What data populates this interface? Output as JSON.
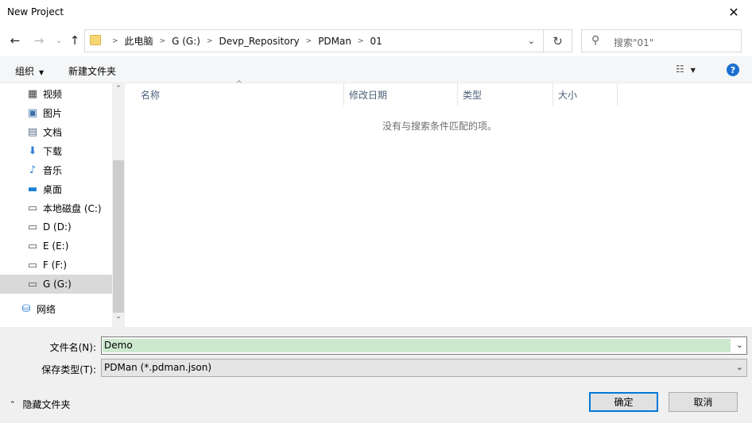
{
  "window": {
    "title": "New Project",
    "close_glyph": "✕"
  },
  "nav": {
    "back_glyph": "←",
    "forward_glyph": "→",
    "recent_glyph": "⌄",
    "up_glyph": "↑",
    "breadcrumbs": [
      "此电脑",
      "G (G:)",
      "Devp_Repository",
      "PDMan",
      "01"
    ],
    "crumb_separator": ">",
    "dropdown_glyph": "⌄",
    "refresh_glyph": "↻"
  },
  "search": {
    "placeholder": "搜索\"01\"",
    "icon": "search-icon"
  },
  "toolbar": {
    "organize_label": "组织",
    "new_folder_label": "新建文件夹",
    "view_glyph": "☷",
    "help_glyph": "?"
  },
  "sidebar": {
    "items": [
      {
        "label": "视频",
        "icon": "video-icon",
        "glyph": "▦",
        "color": "#444444"
      },
      {
        "label": "图片",
        "icon": "pictures-icon",
        "glyph": "▣",
        "color": "#3c6fa8"
      },
      {
        "label": "文档",
        "icon": "documents-icon",
        "glyph": "▤",
        "color": "#5a6f88"
      },
      {
        "label": "下载",
        "icon": "download-icon",
        "glyph": "⬇",
        "color": "#2f7fd6"
      },
      {
        "label": "音乐",
        "icon": "music-icon",
        "glyph": "♪",
        "color": "#2f7fd6"
      },
      {
        "label": "桌面",
        "icon": "desktop-icon",
        "glyph": "▬",
        "color": "#1f7fd3"
      },
      {
        "label": "本地磁盘 (C:)",
        "icon": "system-drive-icon",
        "glyph": "▭",
        "color": "#555555"
      },
      {
        "label": "D (D:)",
        "icon": "drive-icon",
        "glyph": "▭",
        "color": "#555555"
      },
      {
        "label": "E (E:)",
        "icon": "drive-icon",
        "glyph": "▭",
        "color": "#555555"
      },
      {
        "label": "F (F:)",
        "icon": "drive-icon",
        "glyph": "▭",
        "color": "#555555"
      },
      {
        "label": "G (G:)",
        "icon": "drive-icon",
        "glyph": "▭",
        "color": "#555555",
        "selected": true
      },
      {
        "label": "网络",
        "icon": "network-icon",
        "glyph": "⛁",
        "color": "#2f7fd6"
      }
    ],
    "scroll_up_glyph": "⌃",
    "scroll_down_glyph": "⌄"
  },
  "filelist": {
    "columns": [
      "名称",
      "修改日期",
      "类型",
      "大小"
    ],
    "sort_glyph": "^",
    "empty_message": "没有与搜索条件匹配的项。"
  },
  "form": {
    "filename_label": "文件名(N):",
    "filename_value": "Demo",
    "filetype_label": "保存类型(T):",
    "filetype_value": "PDMan (*.pdman.json)",
    "dropdown_glyph": "⌄"
  },
  "footer": {
    "hide_folders_label": "隐藏文件夹",
    "hide_folders_glyph": "⌃",
    "ok_label": "确定",
    "cancel_label": "取消"
  }
}
